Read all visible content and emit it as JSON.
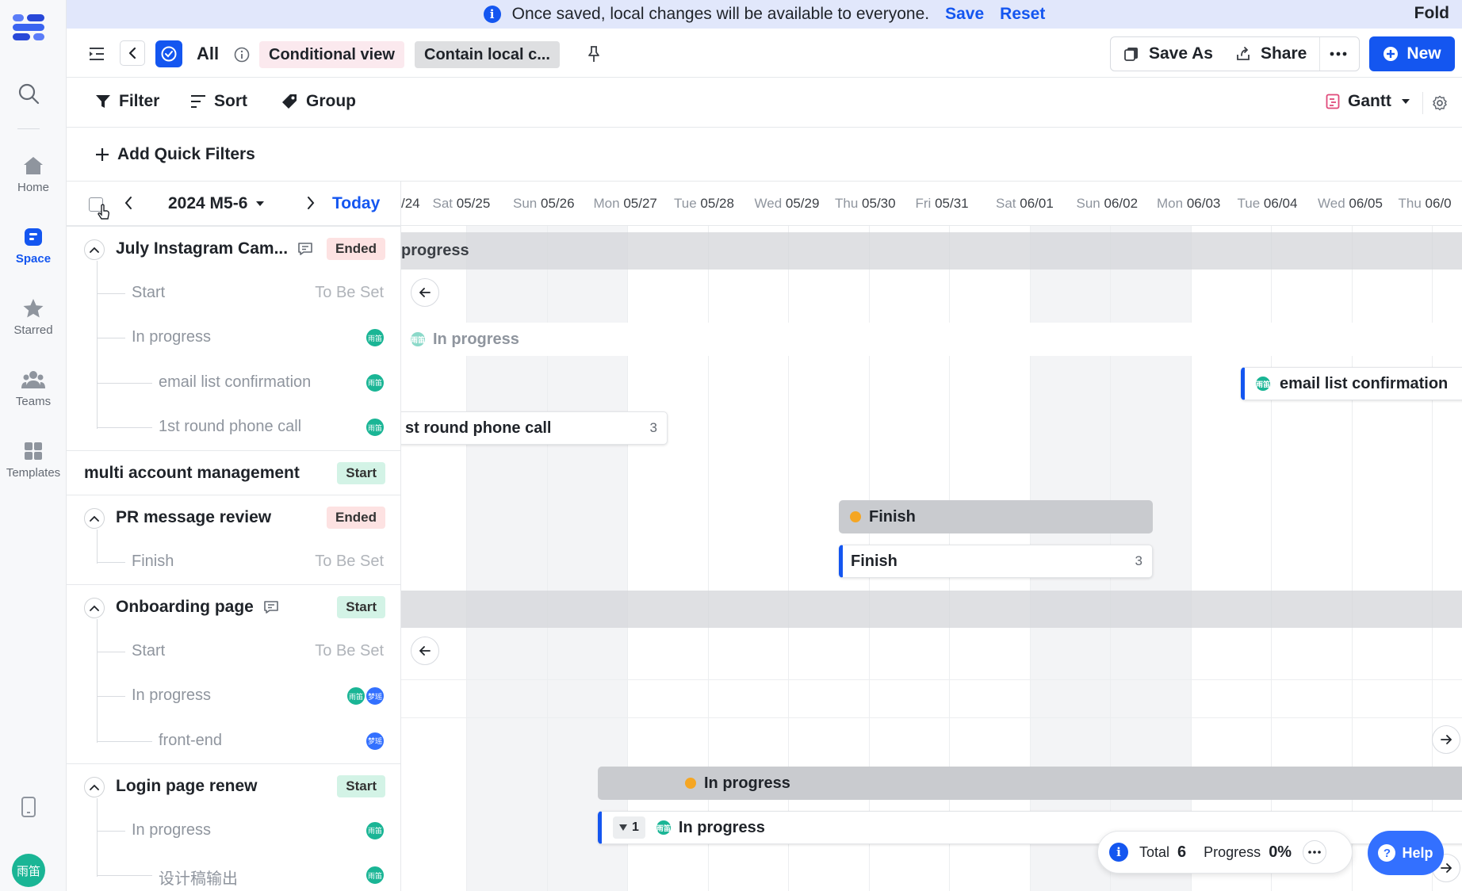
{
  "banner": {
    "message": "Once saved, local changes will be available to everyone.",
    "save": "Save",
    "reset": "Reset",
    "fold": "Fold"
  },
  "rail": {
    "items": [
      {
        "label": "Home",
        "icon": "home-icon"
      },
      {
        "label": "Space",
        "icon": "space-icon"
      },
      {
        "label": "Starred",
        "icon": "star-icon"
      },
      {
        "label": "Teams",
        "icon": "teams-icon"
      },
      {
        "label": "Templates",
        "icon": "templates-icon"
      }
    ],
    "user_avatar": "雨笛",
    "accent": "#1456f0"
  },
  "header": {
    "view_name": "All",
    "conditional_view": "Conditional view",
    "local_changes": "Contain local c...",
    "save_as": "Save As",
    "share": "Share",
    "new": "New"
  },
  "toolbar": {
    "filter": "Filter",
    "sort": "Sort",
    "group": "Group",
    "view_mode": "Gantt"
  },
  "quick_filters": {
    "label": "Add Quick Filters"
  },
  "date_nav": {
    "range": "2024 M5-6",
    "today": "Today"
  },
  "gantt_days": [
    {
      "dow": "",
      "date": "/24"
    },
    {
      "dow": "Sat",
      "date": "05/25"
    },
    {
      "dow": "Sun",
      "date": "05/26"
    },
    {
      "dow": "Mon",
      "date": "05/27"
    },
    {
      "dow": "Tue",
      "date": "05/28"
    },
    {
      "dow": "Wed",
      "date": "05/29"
    },
    {
      "dow": "Thu",
      "date": "05/30"
    },
    {
      "dow": "Fri",
      "date": "05/31"
    },
    {
      "dow": "Sat",
      "date": "06/01"
    },
    {
      "dow": "Sun",
      "date": "06/02"
    },
    {
      "dow": "Mon",
      "date": "06/03"
    },
    {
      "dow": "Tue",
      "date": "06/04"
    },
    {
      "dow": "Wed",
      "date": "06/05"
    },
    {
      "dow": "Thu",
      "date": "06/0"
    }
  ],
  "groups": [
    {
      "title": "July Instagram Cam...",
      "status": "Ended",
      "has_comment": true,
      "subs": [
        {
          "title": "Start",
          "right": "To Be Set",
          "level": 1
        },
        {
          "title": "In progress",
          "avatars": [
            "雨笛"
          ],
          "level": 1
        },
        {
          "title": "email list confirmation",
          "avatars": [
            "雨笛"
          ],
          "level": 2
        },
        {
          "title": "1st round phone call",
          "avatars": [
            "雨笛"
          ],
          "level": 2
        }
      ]
    },
    {
      "title": "multi account management",
      "status": "Start",
      "has_comment": false,
      "subs": []
    },
    {
      "title": "PR message review",
      "status": "Ended",
      "has_comment": false,
      "subs": [
        {
          "title": "Finish",
          "right": "To Be Set",
          "level": 1
        }
      ]
    },
    {
      "title": "Onboarding page",
      "status": "Start",
      "has_comment": true,
      "subs": [
        {
          "title": "Start",
          "right": "To Be Set",
          "level": 1
        },
        {
          "title": "In progress",
          "avatars": [
            "雨笛",
            "梦瑶"
          ],
          "level": 1
        },
        {
          "title": "front-end",
          "avatars": [
            "梦瑶"
          ],
          "level": 2
        }
      ]
    },
    {
      "title": "Login page renew",
      "status": "Start",
      "has_comment": false,
      "subs": [
        {
          "title": "In progress",
          "avatars": [
            "雨笛"
          ],
          "level": 1
        },
        {
          "title": "设计稿输出",
          "avatars": [
            "雨笛"
          ],
          "level": 2
        }
      ]
    }
  ],
  "bars": {
    "july_group": "progress",
    "july_in_progress": "In progress",
    "email_list": "email list confirmation",
    "phone_call": "st round phone call",
    "phone_call_count": "3",
    "pr_group": "Finish",
    "pr_finish": "Finish",
    "pr_finish_count": "3",
    "login_group": "In progress",
    "login_in_progress": "In progress",
    "login_expand": "1"
  },
  "summary": {
    "total_label": "Total",
    "total": "6",
    "progress_label": "Progress",
    "progress": "0%"
  },
  "help": {
    "label": "Help"
  }
}
